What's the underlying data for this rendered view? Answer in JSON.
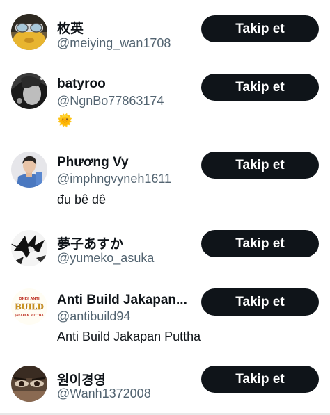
{
  "users": [
    {
      "name": "枚英",
      "handle": "@meiying_wan1708",
      "bio": "",
      "follow_label": "Takip et",
      "avatar": "cartoon-character-avatar"
    },
    {
      "name": "batyroo",
      "handle": "@NgnBo77863174",
      "bio": "🌞",
      "follow_label": "Takip et",
      "avatar": "dark-portrait-avatar"
    },
    {
      "name": "Phương Vy",
      "handle": "@imphngvyneh1611",
      "bio": "đu bê dê",
      "follow_label": "Takip et",
      "avatar": "person-photo-avatar"
    },
    {
      "name": "夢子あすか",
      "handle": "@yumeko_asuka",
      "bio": "",
      "follow_label": "Takip et",
      "avatar": "manga-drawing-avatar"
    },
    {
      "name": "Anti Build Jakapan...",
      "handle": "@antibuild94",
      "bio": "Anti Build Jakapan Puttha",
      "follow_label": "Takip et",
      "avatar": "logo-avatar",
      "avatar_text": [
        "ONLY ANTI",
        "BUILD",
        "JAKAPAN PUTTHA"
      ]
    },
    {
      "name": "원이경영",
      "handle": "@Wanh1372008",
      "bio": "",
      "follow_label": "Takip et",
      "avatar": "eyes-closeup-avatar"
    }
  ],
  "colors": {
    "primary_text": "#0f1419",
    "secondary_text": "#536471",
    "button_bg": "#0f1419",
    "button_text": "#ffffff"
  }
}
